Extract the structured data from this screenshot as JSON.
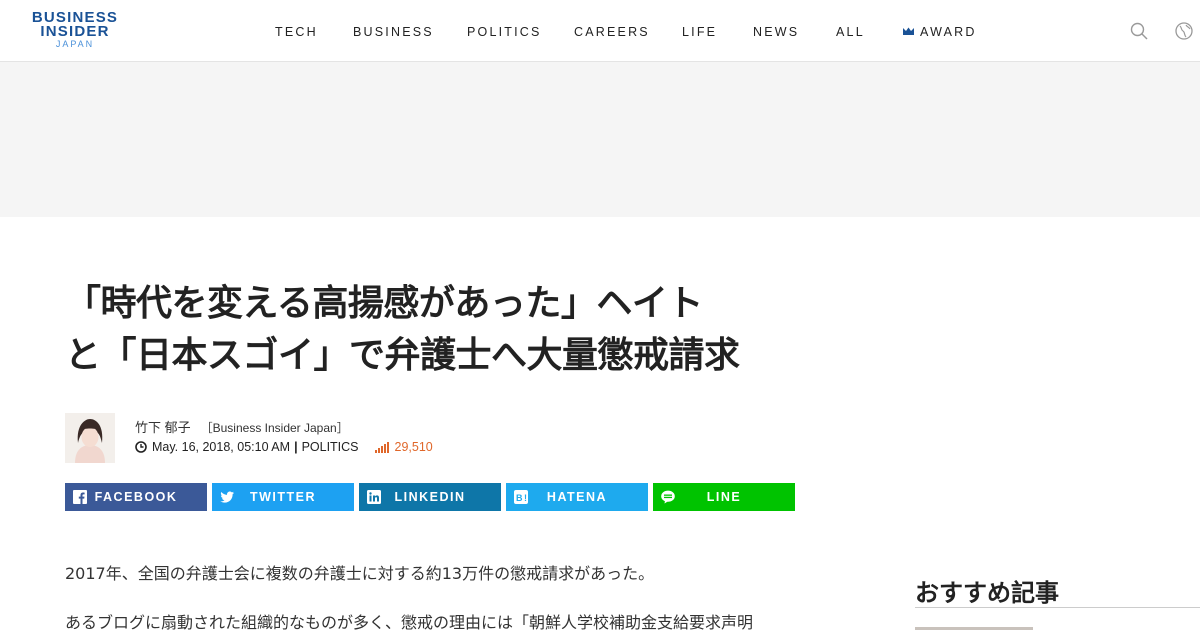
{
  "header": {
    "logo": {
      "line1": "BUSINESS",
      "line2": "INSIDER",
      "line3": "JAPAN"
    },
    "nav": [
      {
        "label": "TECH"
      },
      {
        "label": "BUSINESS"
      },
      {
        "label": "POLITICS"
      },
      {
        "label": "CAREERS"
      },
      {
        "label": "LIFE"
      },
      {
        "label": "NEWS"
      },
      {
        "label": "ALL"
      },
      {
        "label": "AWARD",
        "icon": "award-icon"
      }
    ],
    "icons": [
      "search-icon",
      "globe-icon"
    ]
  },
  "article": {
    "title_line1": "「時代を変える高揚感があった」ヘイト",
    "title_line2": "と「日本スゴイ」で弁護士へ大量懲戒請求",
    "author": "竹下 郁子",
    "publication": "［Business Insider Japan］",
    "date": "May. 16, 2018, 05:10 AM",
    "separator": "|",
    "category": "POLITICS",
    "views": "29,510"
  },
  "share": [
    {
      "label": "FACEBOOK",
      "icon": "facebook-icon",
      "color": "#3b5998"
    },
    {
      "label": "TWITTER",
      "icon": "twitter-icon",
      "color": "#1da1f2"
    },
    {
      "label": "LINKEDIN",
      "icon": "linkedin-icon",
      "color": "#0e76a8"
    },
    {
      "label": "HATENA",
      "icon": "hatena-icon",
      "color": "#1eaaee"
    },
    {
      "label": "LINE",
      "icon": "line-icon",
      "color": "#00c300"
    }
  ],
  "body": {
    "p1": "2017年、全国の弁護士会に複数の弁護士に対する約13万件の懲戒請求があった。",
    "p2": "あるブログに扇動された組織的なものが多く、懲戒の理由には「朝鮮人学校補助金支給要求声明"
  },
  "sidebar": {
    "recommended_title": "おすすめ記事"
  },
  "colors": {
    "brand": "#1a5296",
    "ad_bg": "#f5f5f5",
    "views": "#e0672a"
  }
}
